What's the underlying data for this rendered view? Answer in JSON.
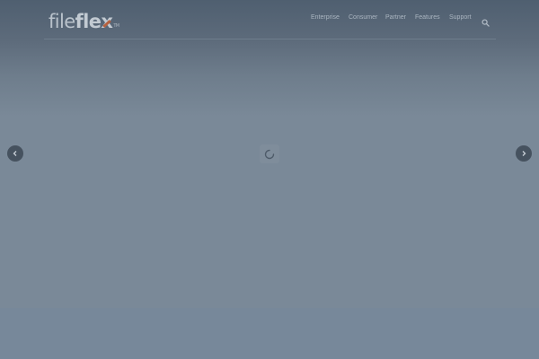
{
  "brand": {
    "logo_part1": "file",
    "logo_part2": "fle",
    "logo_part3": "x",
    "logo_tm": "TM"
  },
  "nav": {
    "items": [
      {
        "label": "Enterprise"
      },
      {
        "label": "Consumer"
      },
      {
        "label": "Partner"
      },
      {
        "label": "Features"
      },
      {
        "label": "Support"
      }
    ],
    "search_icon": "search-icon"
  },
  "slider": {
    "prev_icon": "chevron-left-icon",
    "next_icon": "chevron-right-icon",
    "loading_icon": "spinner-icon"
  },
  "colors": {
    "overlay": "#798896",
    "accent_logo_x": "#b5613f",
    "arrow_bg": "#46525f"
  }
}
